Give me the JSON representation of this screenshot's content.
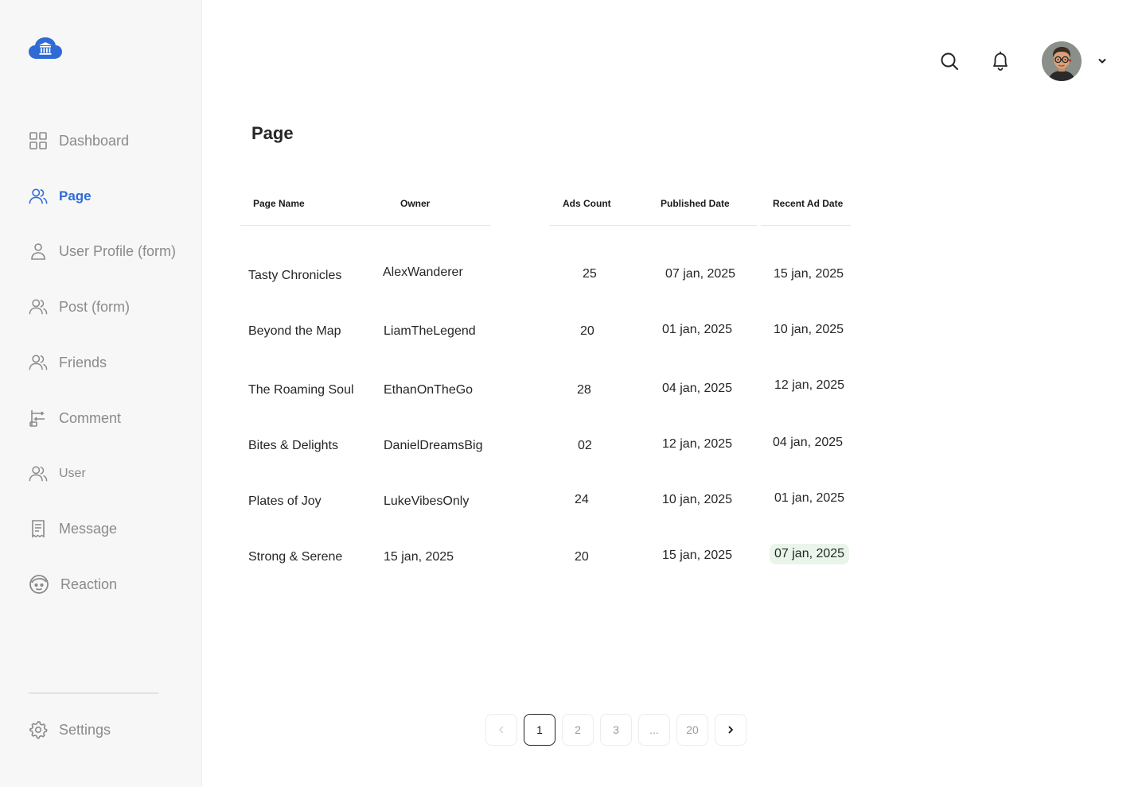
{
  "sidebar": {
    "items": [
      {
        "label": "Dashboard"
      },
      {
        "label": "Page"
      },
      {
        "label": "User Profile (form)"
      },
      {
        "label": "Post (form)"
      },
      {
        "label": "Friends"
      },
      {
        "label": "Comment"
      },
      {
        "label": "User"
      },
      {
        "label": "Message"
      },
      {
        "label": "Reaction"
      }
    ],
    "settings_label": "Settings"
  },
  "main": {
    "title": "Page",
    "columns": [
      "Page Name",
      "Owner",
      "Ads Count",
      "Published Date",
      "Recent Ad Date"
    ],
    "rows": [
      {
        "page_name": "Tasty Chronicles",
        "owner": "AlexWanderer",
        "ads_count": "25",
        "published": "07 jan, 2025",
        "recent": "15 jan, 2025"
      },
      {
        "page_name": "Beyond the Map",
        "owner": "LiamTheLegend",
        "ads_count": "20",
        "published": "01 jan, 2025",
        "recent": "10 jan, 2025"
      },
      {
        "page_name": "The Roaming Soul",
        "owner": "EthanOnTheGo",
        "ads_count": "28",
        "published": "04 jan, 2025",
        "recent": "12 jan, 2025"
      },
      {
        "page_name": "Bites & Delights",
        "owner": "DanielDreamsBig",
        "ads_count": "02",
        "published": "12 jan, 2025",
        "recent": "04 jan, 2025"
      },
      {
        "page_name": "Plates of Joy",
        "owner": "LukeVibesOnly",
        "ads_count": "24",
        "published": "10 jan, 2025",
        "recent": "01 jan, 2025"
      },
      {
        "page_name": "Strong & Serene",
        "owner": "15 jan, 2025",
        "ads_count": "20",
        "published": "15 jan, 2025",
        "recent": "07 jan, 2025"
      }
    ]
  },
  "pagination": {
    "pages": [
      "1",
      "2",
      "3",
      "...",
      "20"
    ],
    "current": "1"
  },
  "colors": {
    "accent": "#2f6bd6",
    "highlight_bg": "#eaf5ea"
  }
}
